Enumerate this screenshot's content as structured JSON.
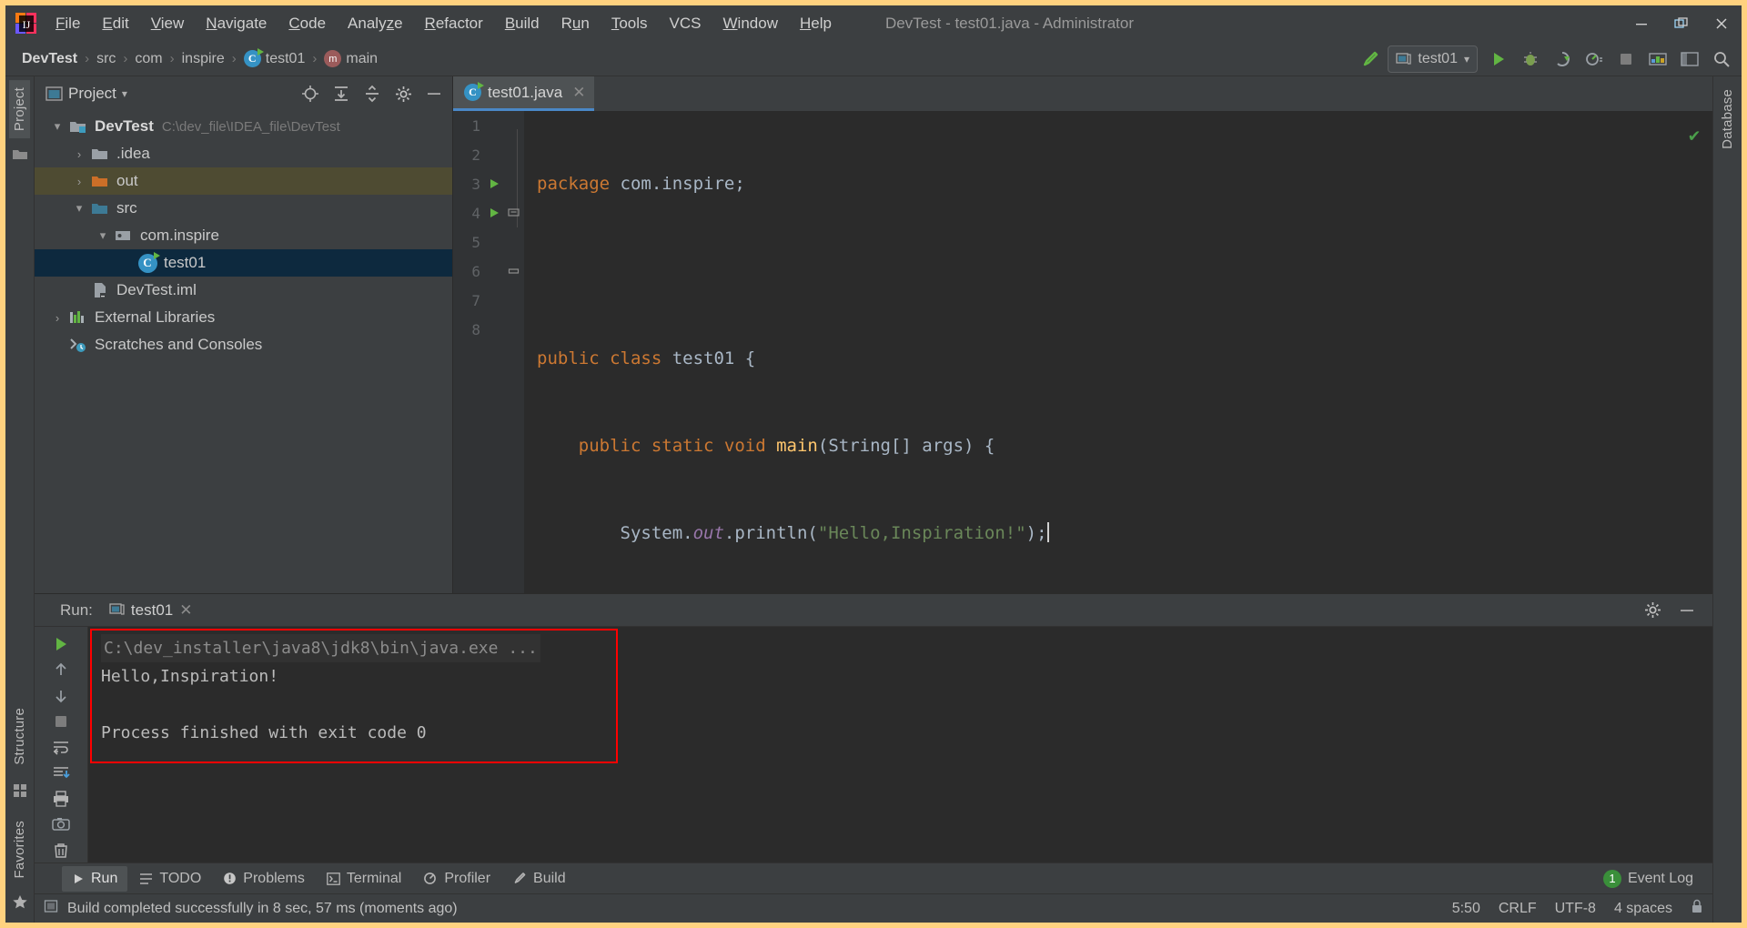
{
  "window": {
    "title": "DevTest - test01.java - Administrator",
    "minimize_label": "–",
    "restore_label": "❐",
    "close_label": "✕",
    "logo_icon": "intellij-idea-logo"
  },
  "menubar": {
    "items": [
      {
        "label": "File",
        "mnemonic": "F"
      },
      {
        "label": "Edit",
        "mnemonic": "E"
      },
      {
        "label": "View",
        "mnemonic": "V"
      },
      {
        "label": "Navigate",
        "mnemonic": "N"
      },
      {
        "label": "Code",
        "mnemonic": "C"
      },
      {
        "label": "Analyze",
        "mnemonic": "z"
      },
      {
        "label": "Refactor",
        "mnemonic": "R"
      },
      {
        "label": "Build",
        "mnemonic": "B"
      },
      {
        "label": "Run",
        "mnemonic": "u"
      },
      {
        "label": "Tools",
        "mnemonic": "T"
      },
      {
        "label": "VCS",
        "mnemonic": ""
      },
      {
        "label": "Window",
        "mnemonic": "W"
      },
      {
        "label": "Help",
        "mnemonic": "H"
      }
    ]
  },
  "navbar": {
    "breadcrumbs": [
      {
        "label": "DevTest",
        "icon": "",
        "bold": true
      },
      {
        "label": "src",
        "icon": "",
        "bold": false
      },
      {
        "label": "com",
        "icon": "",
        "bold": false
      },
      {
        "label": "inspire",
        "icon": "",
        "bold": false
      },
      {
        "label": "test01",
        "icon": "class-icon",
        "bold": false
      },
      {
        "label": "main",
        "icon": "method-icon",
        "bold": false
      }
    ],
    "separator": "›",
    "build_icon": "hammer-icon",
    "run_configuration": "test01",
    "run_config_icon": "run-config-icon",
    "dropdown_icon": "▾",
    "buttons": [
      {
        "name": "run-button",
        "icon": "▶"
      },
      {
        "name": "debug-button",
        "icon": "debug-icon"
      },
      {
        "name": "run-coverage-button",
        "icon": "coverage-icon"
      },
      {
        "name": "profiler-button",
        "icon": "profiler-icon"
      },
      {
        "name": "stop-button",
        "icon": "■"
      },
      {
        "name": "updates-button",
        "icon": "updates-icon"
      },
      {
        "name": "layout-button",
        "icon": "layout-icon"
      },
      {
        "name": "search-button",
        "icon": "search-icon"
      }
    ]
  },
  "left_stripe": {
    "top": [
      {
        "label": "Project",
        "active": true
      }
    ],
    "bottom": [
      {
        "label": "Structure"
      },
      {
        "label": "Favorites"
      }
    ]
  },
  "right_stripe": {
    "items": [
      {
        "label": "Database"
      }
    ]
  },
  "project_panel": {
    "title": "Project",
    "title_icon": "project-icon",
    "dropdown_icon": "▾",
    "toolbar": [
      {
        "name": "locate-file-button",
        "icon": "target-icon"
      },
      {
        "name": "expand-all-button",
        "icon": "expand-icon"
      },
      {
        "name": "collapse-all-button",
        "icon": "collapse-icon"
      },
      {
        "name": "settings-button",
        "icon": "gear-icon"
      },
      {
        "name": "hide-panel-button",
        "icon": "minimize-icon"
      }
    ],
    "tree": [
      {
        "label": "DevTest",
        "path": "C:\\dev_file\\IDEA_file\\DevTest",
        "icon": "module-folder-icon",
        "twist": "▾",
        "indent": 0,
        "bold": true,
        "state": ""
      },
      {
        "label": ".idea",
        "path": "",
        "icon": "folder-gray-icon",
        "twist": "›",
        "indent": 1,
        "bold": false,
        "state": ""
      },
      {
        "label": "out",
        "path": "",
        "icon": "folder-orange-icon",
        "twist": "›",
        "indent": 1,
        "bold": false,
        "state": "highlight"
      },
      {
        "label": "src",
        "path": "",
        "icon": "folder-blue-icon",
        "twist": "▾",
        "indent": 1,
        "bold": false,
        "state": ""
      },
      {
        "label": "com.inspire",
        "path": "",
        "icon": "package-icon",
        "twist": "▾",
        "indent": 2,
        "bold": false,
        "state": ""
      },
      {
        "label": "test01",
        "path": "",
        "icon": "class-icon",
        "twist": "",
        "indent": 3,
        "bold": false,
        "state": "selected"
      },
      {
        "label": "DevTest.iml",
        "path": "",
        "icon": "iml-file-icon",
        "twist": "",
        "indent": 1,
        "bold": false,
        "state": ""
      },
      {
        "label": "External Libraries",
        "path": "",
        "icon": "libraries-icon",
        "twist": "›",
        "indent": 0,
        "bold": false,
        "state": ""
      },
      {
        "label": "Scratches and Consoles",
        "path": "",
        "icon": "scratches-icon",
        "twist": "",
        "indent": 0,
        "bold": false,
        "state": ""
      }
    ]
  },
  "editor": {
    "tab": {
      "label": "test01.java",
      "icon": "class-icon",
      "close_icon": "✕"
    },
    "inspection_status": "✔",
    "lines": [
      {
        "num": "1",
        "runmark": false,
        "fold": "",
        "tokens": [
          {
            "t": "package ",
            "c": "k"
          },
          {
            "t": "com.inspire;",
            "c": "pl"
          }
        ]
      },
      {
        "num": "2",
        "runmark": false,
        "fold": "",
        "tokens": []
      },
      {
        "num": "3",
        "runmark": true,
        "fold": "",
        "tokens": [
          {
            "t": "public class ",
            "c": "k"
          },
          {
            "t": "test01 ",
            "c": "cls"
          },
          {
            "t": "{",
            "c": "pl"
          }
        ]
      },
      {
        "num": "4",
        "runmark": true,
        "fold": "▽",
        "tokens": [
          {
            "t": "    public static void ",
            "c": "k"
          },
          {
            "t": "main",
            "c": "mth"
          },
          {
            "t": "(String[] args) {",
            "c": "pl"
          }
        ]
      },
      {
        "num": "5",
        "runmark": false,
        "fold": "",
        "tokens": [
          {
            "t": "        System.",
            "c": "pl"
          },
          {
            "t": "out",
            "c": "fld"
          },
          {
            "t": ".println(",
            "c": "pl"
          },
          {
            "t": "\"Hello,Inspiration!\"",
            "c": "str"
          },
          {
            "t": ");",
            "c": "pl"
          }
        ]
      },
      {
        "num": "6",
        "runmark": false,
        "fold": "△",
        "tokens": [
          {
            "t": "    }",
            "c": "pl"
          }
        ]
      },
      {
        "num": "7",
        "runmark": false,
        "fold": "",
        "tokens": [
          {
            "t": "}",
            "c": "pl"
          }
        ]
      },
      {
        "num": "8",
        "runmark": false,
        "fold": "",
        "tokens": []
      }
    ]
  },
  "run_panel": {
    "label": "Run:",
    "tab": {
      "label": "test01",
      "icon": "run-config-icon",
      "close_icon": "✕"
    },
    "settings_icon": "gear-icon",
    "minimize_icon": "minimize-icon",
    "tools": [
      {
        "name": "rerun-button",
        "icon": "▶"
      },
      {
        "name": "up-stacktrace-button",
        "icon": "↑"
      },
      {
        "name": "down-stacktrace-button",
        "icon": "↓"
      },
      {
        "name": "stop-button",
        "icon": "■"
      },
      {
        "name": "soft-wrap-button",
        "icon": "wrap-icon"
      },
      {
        "name": "scroll-to-end-button",
        "icon": "scroll-end-icon"
      },
      {
        "name": "print-button",
        "icon": "print-icon"
      },
      {
        "name": "screenshot-button",
        "icon": "camera-icon"
      },
      {
        "name": "clear-all-button",
        "icon": "trash-icon"
      }
    ],
    "console": {
      "command": "C:\\dev_installer\\java8\\jdk8\\bin\\java.exe ...",
      "output": "Hello,Inspiration!",
      "blank": "",
      "exit": "Process finished with exit code 0",
      "highlight_color": "#ff0000"
    }
  },
  "bottom_bar": {
    "items": [
      {
        "label": "Run",
        "icon": "▶",
        "active": true
      },
      {
        "label": "TODO",
        "icon": "todo-icon",
        "active": false
      },
      {
        "label": "Problems",
        "icon": "problems-icon",
        "active": false
      },
      {
        "label": "Terminal",
        "icon": "terminal-icon",
        "active": false
      },
      {
        "label": "Profiler",
        "icon": "profiler-icon",
        "active": false
      },
      {
        "label": "Build",
        "icon": "hammer-icon",
        "active": false
      }
    ],
    "event_log": {
      "label": "Event Log",
      "count": "1"
    }
  },
  "status_bar": {
    "icon": "memory-icon",
    "message": "Build completed successfully in 8 sec, 57 ms (moments ago)",
    "caret_position": "5:50",
    "line_separator": "CRLF",
    "encoding": "UTF-8",
    "indent": "4 spaces",
    "lock_icon": "lock-icon"
  },
  "colors": {
    "window_border": "#ffd27f",
    "chrome": "#3c3f41",
    "editor_bg": "#2b2b2b",
    "selection": "#0d293e",
    "highlight_row": "#4e4b32",
    "accent_blue": "#4a88c7",
    "keyword_orange": "#cc7832",
    "string_green": "#6a8759",
    "method_yellow": "#ffc66d",
    "field_purple": "#9876aa",
    "red_box": "#ff0000",
    "green_run": "#62b543"
  }
}
